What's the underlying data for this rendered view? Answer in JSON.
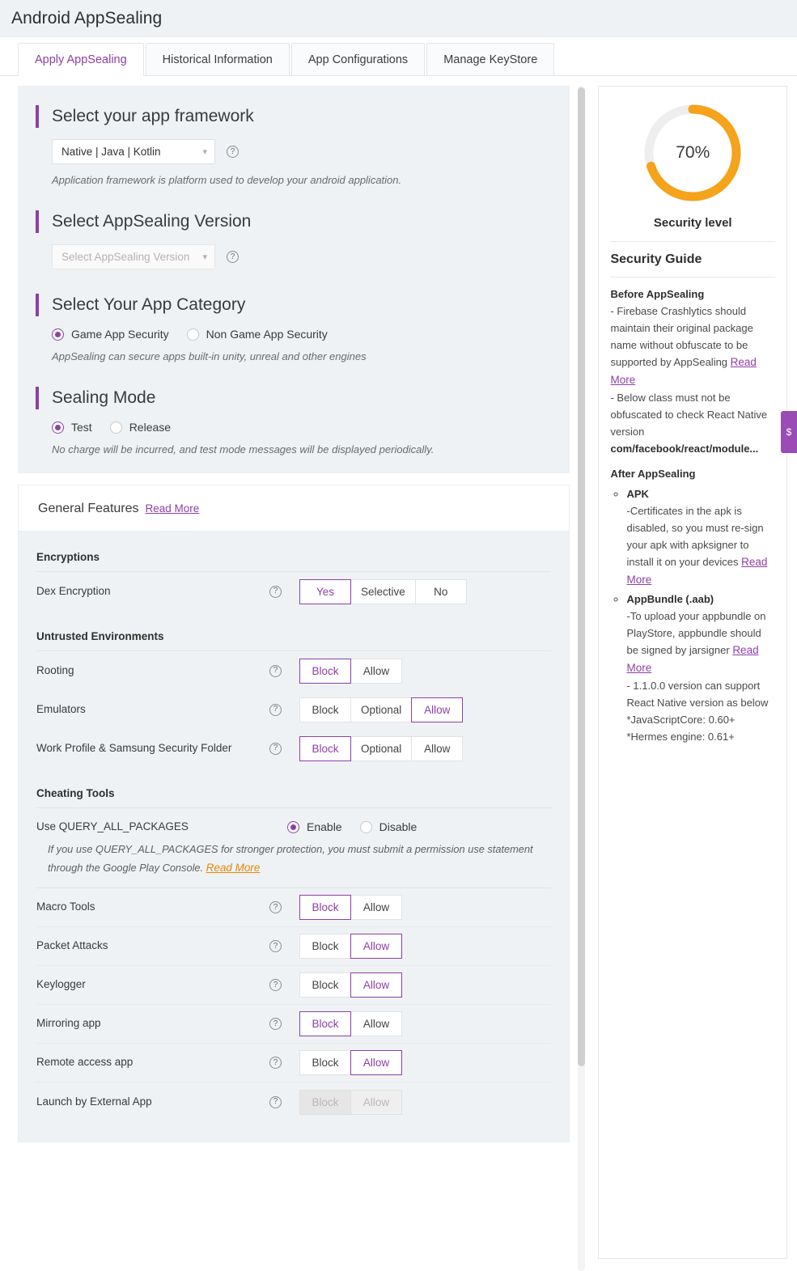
{
  "header": {
    "title": "Android AppSealing"
  },
  "tabs": [
    {
      "label": "Apply AppSealing",
      "active": true
    },
    {
      "label": "Historical Information",
      "active": false
    },
    {
      "label": "App Configurations",
      "active": false
    },
    {
      "label": "Manage KeyStore",
      "active": false
    }
  ],
  "framework": {
    "title": "Select your app framework",
    "selected": "Native | Java | Kotlin",
    "hint": "Application framework is platform used to develop your android application."
  },
  "version": {
    "title": "Select AppSealing Version",
    "placeholder": "Select AppSealing Version"
  },
  "category": {
    "title": "Select Your App Category",
    "options": [
      {
        "label": "Game App Security",
        "selected": true
      },
      {
        "label": "Non Game App Security",
        "selected": false
      }
    ],
    "hint": "AppSealing can secure apps built-in unity, unreal and other engines"
  },
  "sealing_mode": {
    "title": "Sealing Mode",
    "options": [
      {
        "label": "Test",
        "selected": true
      },
      {
        "label": "Release",
        "selected": false
      }
    ],
    "hint": "No charge will be incurred, and test mode messages will be displayed periodically."
  },
  "general_features": {
    "heading": "General Features",
    "read_more": "Read More",
    "groups": [
      {
        "name": "Encryptions",
        "rows": [
          {
            "label": "Dex Encryption",
            "options": [
              "Yes",
              "Selective",
              "No"
            ],
            "selected": "Yes",
            "disabled": false
          }
        ]
      },
      {
        "name": "Untrusted Environments",
        "rows": [
          {
            "label": "Rooting",
            "options": [
              "Block",
              "Allow"
            ],
            "selected": "Block",
            "disabled": false
          },
          {
            "label": "Emulators",
            "options": [
              "Block",
              "Optional",
              "Allow"
            ],
            "selected": "Allow",
            "disabled": false
          },
          {
            "label": "Work Profile & Samsung Security Folder",
            "options": [
              "Block",
              "Optional",
              "Allow"
            ],
            "selected": "Block",
            "disabled": false
          }
        ]
      },
      {
        "name": "Cheating Tools",
        "query_all_packages": {
          "label": "Use QUERY_ALL_PACKAGES",
          "options": [
            {
              "label": "Enable",
              "selected": true
            },
            {
              "label": "Disable",
              "selected": false
            }
          ],
          "hint_part1": "If you use QUERY_ALL_PACKAGES for stronger protection, you must submit a permission use statement through the Google Play Console.",
          "hint_link": "Read More"
        },
        "rows": [
          {
            "label": "Macro Tools",
            "options": [
              "Block",
              "Allow"
            ],
            "selected": "Block",
            "disabled": false
          },
          {
            "label": "Packet Attacks",
            "options": [
              "Block",
              "Allow"
            ],
            "selected": "Allow",
            "disabled": false
          },
          {
            "label": "Keylogger",
            "options": [
              "Block",
              "Allow"
            ],
            "selected": "Allow",
            "disabled": false
          },
          {
            "label": "Mirroring app",
            "options": [
              "Block",
              "Allow"
            ],
            "selected": "Block",
            "disabled": false
          },
          {
            "label": "Remote access app",
            "options": [
              "Block",
              "Allow"
            ],
            "selected": "Allow",
            "disabled": false
          },
          {
            "label": "Launch by External App",
            "options": [
              "Block",
              "Allow"
            ],
            "selected": "",
            "disabled": true
          }
        ]
      }
    ]
  },
  "security_panel": {
    "gauge_value": "70%",
    "gauge_percent": 70,
    "gauge_color": "#f5a31a",
    "gauge_track_color": "#eeeeee",
    "gauge_label": "Security level",
    "guide_title": "Security Guide",
    "before_heading": "Before AppSealing",
    "before_line1": "- Firebase Crashlytics should maintain their original package name without obfuscate to be supported by AppSealing",
    "before_link1": "Read More",
    "before_line2": "- Below class must not be obfuscated to check React Native version",
    "before_class": "com/facebook/react/module...",
    "after_heading": "After AppSealing",
    "items": [
      {
        "title": "APK",
        "text": "-Certificates in the apk is disabled, so you must re-sign your apk with apksigner to install it on your devices",
        "link": "Read More"
      },
      {
        "title": "AppBundle (.aab)",
        "text": "-To upload your appbundle on PlayStore, appbundle should be signed by jarsigner",
        "link": "Read More"
      }
    ],
    "footer_line1": "- 1.1.0.0 version can support React Native version as below",
    "footer_line2": "*JavaScriptCore: 0.60+",
    "footer_line3": "*Hermes engine: 0.61+"
  },
  "edge_tab": {
    "label": "$"
  },
  "colors": {
    "accent": "#8e3fa8",
    "panel_bg": "#eef2f5",
    "orange": "#e8880a"
  }
}
